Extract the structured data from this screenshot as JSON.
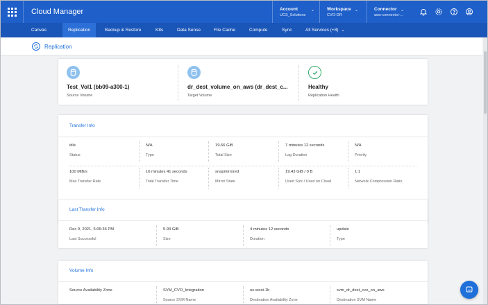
{
  "topbar": {
    "title": "Cloud Manager",
    "account": {
      "label": "Account",
      "value": "UCS_Solutions"
    },
    "workspace": {
      "label": "Workspace",
      "value": "CVO-DR"
    },
    "connector": {
      "label": "Connector",
      "value": "aws-connector-..."
    },
    "icons": [
      "bell-icon",
      "gear-icon",
      "help-icon",
      "user-icon"
    ]
  },
  "nav": {
    "items": [
      "Canvas",
      "Replication",
      "Backup & Restore",
      "K8s",
      "Data Sense",
      "File Cache",
      "Compute",
      "Sync",
      "All Services (+8)"
    ],
    "active": "Replication"
  },
  "page": {
    "title": "Replication"
  },
  "summary": {
    "source": {
      "name": "Test_Vol1 (bb09-a300-1)",
      "label": "Source Volume"
    },
    "target": {
      "name": "dr_dest_volume_on_aws (dr_dest_c...",
      "label": "Target Volume"
    },
    "health": {
      "name": "Healthy",
      "label": "Replication Health"
    }
  },
  "transfer_info": {
    "title": "Transfer Info",
    "row1": [
      {
        "value": "idle",
        "label": "Status"
      },
      {
        "value": "N/A",
        "label": "Type"
      },
      {
        "value": "19.66 GiB",
        "label": "Total Size"
      },
      {
        "value": "7 minutes 12 seconds",
        "label": "Lag Duration"
      },
      {
        "value": "N/A",
        "label": "Priority"
      }
    ],
    "row2": [
      {
        "value": "100 MiB/s",
        "label": "Max Transfer Rate"
      },
      {
        "value": "16 minutes 41 seconds",
        "label": "Total Transfer Time"
      },
      {
        "value": "snapmirrored",
        "label": "Mirror State"
      },
      {
        "value": "19.43 GiB / 0 B",
        "label": "Used Size / Used on Cloud"
      },
      {
        "value": "1:1",
        "label": "Network Compression Ratio"
      }
    ]
  },
  "last_transfer": {
    "title": "Last Transfer Info",
    "row": [
      {
        "value": "Dec 9, 2021, 5:06:36 PM",
        "label": "Last Successful"
      },
      {
        "value": "5.93 GiB",
        "label": "Size"
      },
      {
        "value": "4 minutes 12 seconds",
        "label": "Duration"
      },
      {
        "value": "update",
        "label": "Type"
      }
    ]
  },
  "volume_info": {
    "title": "Volume Info",
    "row": [
      {
        "value": "",
        "label": "Source Availability Zone"
      },
      {
        "value": "SVM_CVO_Integration",
        "label": "Source SVM Name"
      },
      {
        "value": "us-west-1b",
        "label": "Destination Availability Zone"
      },
      {
        "value": "svm_dr_dest_cvo_on_aws",
        "label": "Destination SVM Name"
      }
    ]
  },
  "colors": {
    "header": "#1e5fc9",
    "nav": "#1a55b8",
    "accent": "#1e6fd9",
    "healthy": "#2eaa6a"
  }
}
